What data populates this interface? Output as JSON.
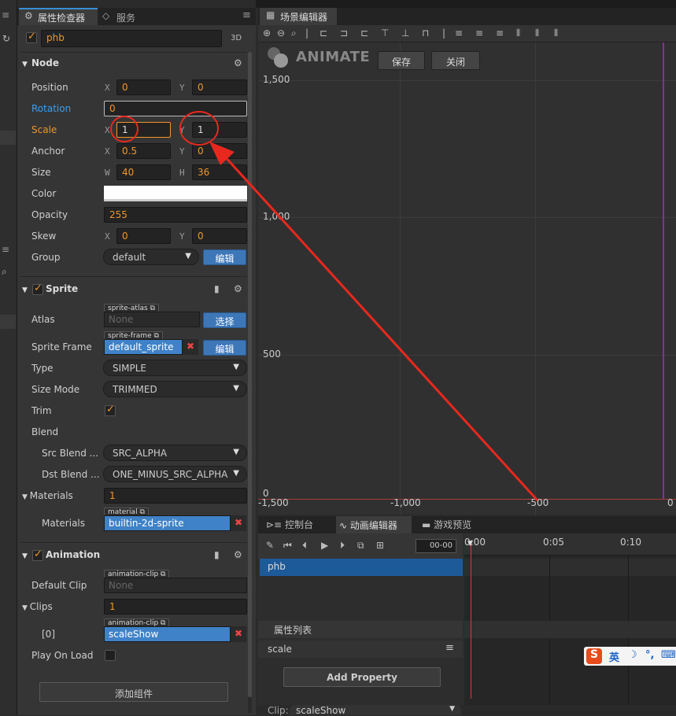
{
  "inspector": {
    "tab_label": "属性检查器",
    "tab2_label": "服务",
    "node_name": "phb",
    "badge_3d": "3D",
    "node_section": "Node",
    "fields": {
      "position": {
        "label": "Position",
        "x": "0",
        "y": "0"
      },
      "rotation": {
        "label": "Rotation",
        "value": "0"
      },
      "scale": {
        "label": "Scale",
        "x": "1",
        "y": "1"
      },
      "anchor": {
        "label": "Anchor",
        "x": "0.5",
        "y": "0"
      },
      "size": {
        "label": "Size",
        "w": "40",
        "h": "36"
      },
      "color": {
        "label": "Color",
        "value": "#ffffff"
      },
      "opacity": {
        "label": "Opacity",
        "value": "255"
      },
      "skew": {
        "label": "Skew",
        "x": "0",
        "y": "0"
      },
      "group": {
        "label": "Group",
        "value": "default",
        "edit": "编辑"
      }
    },
    "axis_x": "X",
    "axis_y": "Y",
    "axis_w": "W",
    "axis_h": "H",
    "sprite": {
      "section": "Sprite",
      "atlas_label": "Atlas",
      "atlas_tag": "sprite-atlas",
      "atlas_value": "None",
      "atlas_btn": "选择",
      "frame_label": "Sprite Frame",
      "frame_tag": "sprite-frame",
      "frame_value": "default_sprite",
      "frame_btn": "编辑",
      "type_label": "Type",
      "type_value": "SIMPLE",
      "sizemode_label": "Size Mode",
      "sizemode_value": "TRIMMED",
      "trim_label": "Trim",
      "blend_label": "Blend",
      "src_label": "Src Blend ...",
      "src_value": "SRC_ALPHA",
      "dst_label": "Dst Blend ...",
      "dst_value": "ONE_MINUS_SRC_ALPHA",
      "materials_label": "Materials",
      "materials_count": "1",
      "material_tag": "material",
      "material_value": "builtin-2d-sprite",
      "materials_item_label": "Materials"
    },
    "animation": {
      "section": "Animation",
      "default_clip_label": "Default Clip",
      "clip_tag": "animation-clip",
      "default_clip_value": "None",
      "clips_label": "Clips",
      "clips_count": "1",
      "clip_index": "[0]",
      "clip_value": "scaleShow",
      "play_on_load_label": "Play On Load"
    },
    "add_component": "添加组件"
  },
  "scene": {
    "tab_label": "场景编辑器",
    "logo": "ANIMATE",
    "save": "保存",
    "close": "关闭",
    "y_labels": [
      "1,500",
      "1,000",
      "500",
      "0"
    ],
    "x_labels": [
      "-1,500",
      "-1,000",
      "-500",
      "0"
    ]
  },
  "anim": {
    "tabs": [
      "控制台",
      "动画编辑器",
      "游戏预览"
    ],
    "time_field": "00-00",
    "ticks": [
      "0:00",
      "0:05",
      "0:10"
    ],
    "node_name": "phb",
    "props_header": "属性列表",
    "prop_name": "scale",
    "add_property": "Add Property",
    "clip_label": "Clip:",
    "clip_value": "scaleShow"
  },
  "ime": {
    "lang": "英",
    "items": [
      "☽",
      "°,",
      "⌨"
    ]
  }
}
